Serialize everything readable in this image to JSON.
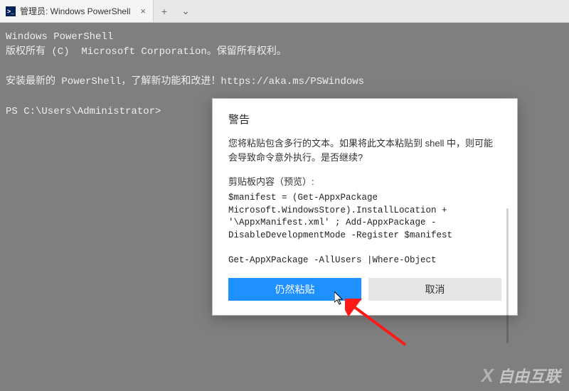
{
  "tab": {
    "icon_label": ">_",
    "title": "管理员: Windows PowerShell",
    "close": "×",
    "new": "+",
    "dropdown": "⌄"
  },
  "terminal": {
    "line1": "Windows PowerShell",
    "line2": "版权所有 (C)  Microsoft Corporation。保留所有权利。",
    "blank1": "",
    "line3": "安装最新的 PowerShell，了解新功能和改进！https://aka.ms/PSWindows",
    "blank2": "",
    "prompt": "PS C:\\Users\\Administrator>"
  },
  "dialog": {
    "title": "警告",
    "message": "您将粘贴包含多行的文本。如果将此文本粘贴到 shell 中，则可能会导致命令意外执行。是否继续?",
    "preview_label": "剪贴板内容（预览）:",
    "preview": "$manifest = (Get-AppxPackage Microsoft.WindowsStore).InstallLocation + '\\AppxManifest.xml' ; Add-AppxPackage -DisableDevelopmentMode -Register $manifest\n\nGet-AppXPackage -AllUsers |Where-Object",
    "paste": "仍然粘贴",
    "cancel": "取消"
  },
  "watermark": {
    "x": "X",
    "text": "自由互联"
  }
}
